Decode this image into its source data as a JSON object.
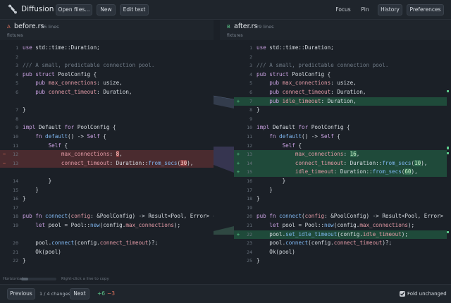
{
  "app": {
    "name": "Diffusion"
  },
  "toolbar": {
    "open_label": "Open files...",
    "new_label": "New",
    "edit_label": "Edit text",
    "focus_label": "Focus",
    "pin_label": "Pin",
    "history_label": "History",
    "preferences_label": "Preferences"
  },
  "left_file": {
    "letter": "A",
    "name": "before.rs",
    "lines": "26 lines",
    "folder": "fixtures"
  },
  "right_file": {
    "letter": "B",
    "name": "after.rs",
    "lines": "29 lines",
    "folder": "fixtures"
  },
  "colors": {
    "accent_removed": "#e0735d",
    "accent_added": "#5cc98a",
    "del_bg": "#4a2b2f",
    "add_bg": "#1f4a3a"
  },
  "left_lines": [
    {
      "n": "1",
      "text": "use std::time::Duration;",
      "kind": "ctx"
    },
    {
      "n": "2",
      "text": "",
      "kind": "ctx"
    },
    {
      "n": "3",
      "text": "/// A small, predictable connection pool.",
      "kind": "ctx"
    },
    {
      "n": "4",
      "text": "pub struct PoolConfig {",
      "kind": "ctx"
    },
    {
      "n": "5",
      "text": "    pub max_connections: usize,",
      "kind": "ctx"
    },
    {
      "n": "6",
      "text": "    pub connect_timeout: Duration,",
      "kind": "ctx"
    },
    {
      "n": "7",
      "text": "}",
      "kind": "ctx"
    },
    {
      "n": "8",
      "text": "",
      "kind": "ctx"
    },
    {
      "n": "9",
      "text": "impl Default for PoolConfig {",
      "kind": "ctx"
    },
    {
      "n": "10",
      "text": "    fn default() -> Self {",
      "kind": "ctx"
    },
    {
      "n": "11",
      "text": "        Self {",
      "kind": "ctx"
    },
    {
      "n": "12",
      "text": "            max_connections: 8,",
      "kind": "del"
    },
    {
      "n": "13",
      "text": "            connect_timeout: Duration::from_secs(30),",
      "kind": "del"
    },
    {
      "n": "14",
      "text": "        }",
      "kind": "ctx"
    },
    {
      "n": "15",
      "text": "    }",
      "kind": "ctx"
    },
    {
      "n": "16",
      "text": "}",
      "kind": "ctx"
    },
    {
      "n": "17",
      "text": "",
      "kind": "ctx"
    },
    {
      "n": "18",
      "text": "pub fn connect(config: &PoolConfig) -> Result<Pool, Error> {",
      "kind": "ctx"
    },
    {
      "n": "19",
      "text": "    let pool = Pool::new(config.max_connections);",
      "kind": "ctx"
    },
    {
      "n": "20",
      "text": "    pool.connect(config.connect_timeout)?;",
      "kind": "ctx"
    },
    {
      "n": "21",
      "text": "    Ok(pool)",
      "kind": "ctx"
    },
    {
      "n": "22",
      "text": "}",
      "kind": "ctx"
    }
  ],
  "right_lines": [
    {
      "n": "1",
      "text": "use std::time::Duration;",
      "kind": "ctx"
    },
    {
      "n": "2",
      "text": "",
      "kind": "ctx"
    },
    {
      "n": "3",
      "text": "/// A small, predictable connection pool.",
      "kind": "ctx"
    },
    {
      "n": "4",
      "text": "pub struct PoolConfig {",
      "kind": "ctx"
    },
    {
      "n": "5",
      "text": "    pub max_connections: usize,",
      "kind": "ctx"
    },
    {
      "n": "6",
      "text": "    pub connect_timeout: Duration,",
      "kind": "ctx"
    },
    {
      "n": "7",
      "text": "    pub idle_timeout: Duration,",
      "kind": "add"
    },
    {
      "n": "8",
      "text": "}",
      "kind": "ctx"
    },
    {
      "n": "9",
      "text": "",
      "kind": "ctx"
    },
    {
      "n": "10",
      "text": "impl Default for PoolConfig {",
      "kind": "ctx"
    },
    {
      "n": "11",
      "text": "    fn default() -> Self {",
      "kind": "ctx"
    },
    {
      "n": "12",
      "text": "        Self {",
      "kind": "ctx"
    },
    {
      "n": "13",
      "text": "            max_connections: 16,",
      "kind": "add"
    },
    {
      "n": "14",
      "text": "            connect_timeout: Duration::from_secs(10),",
      "kind": "add"
    },
    {
      "n": "15",
      "text": "            idle_timeout: Duration::from_secs(60),",
      "kind": "add"
    },
    {
      "n": "16",
      "text": "        }",
      "kind": "ctx"
    },
    {
      "n": "17",
      "text": "    }",
      "kind": "ctx"
    },
    {
      "n": "18",
      "text": "}",
      "kind": "ctx"
    },
    {
      "n": "19",
      "text": "",
      "kind": "ctx"
    },
    {
      "n": "20",
      "text": "pub fn connect(config: &PoolConfig) -> Result<Pool, Error> {",
      "kind": "ctx"
    },
    {
      "n": "21",
      "text": "    let pool = Pool::new(config.max_connections);",
      "kind": "ctx"
    },
    {
      "n": "22",
      "text": "    pool.set_idle_timeout(config.idle_timeout);",
      "kind": "add"
    },
    {
      "n": "23",
      "text": "    pool.connect(config.connect_timeout)?;",
      "kind": "ctx"
    },
    {
      "n": "24",
      "text": "    Ok(pool)",
      "kind": "ctx"
    },
    {
      "n": "25",
      "text": "}",
      "kind": "ctx"
    }
  ],
  "footer": {
    "horizontal_label": "Horizontal",
    "hint": "Right-click a line to copy",
    "previous_label": "Previous",
    "changes": "1 / 4 changes",
    "next_label": "Next",
    "added": "+6",
    "removed": "−3",
    "fold_label": "Fold unchanged"
  }
}
